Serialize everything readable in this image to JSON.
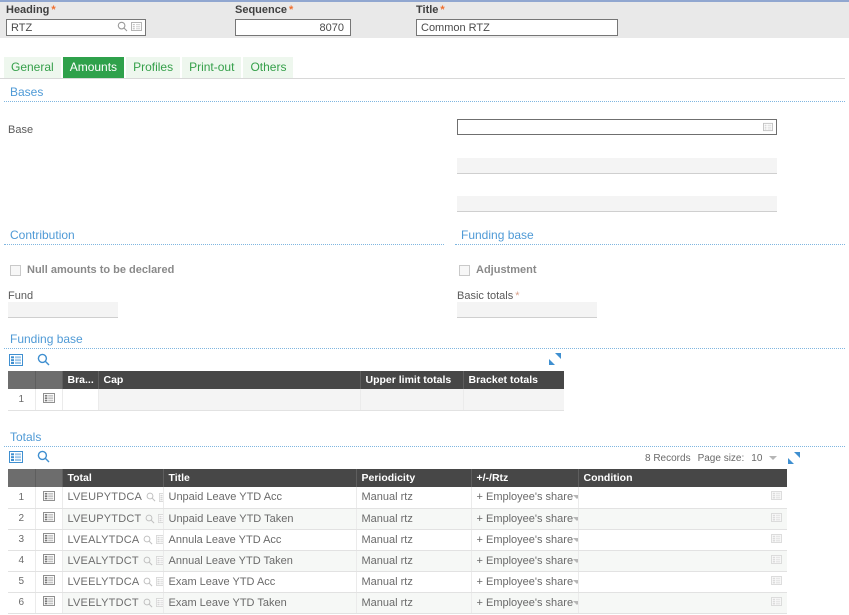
{
  "header": {
    "heading": {
      "label": "Heading",
      "value": "RTZ",
      "required": true
    },
    "sequence": {
      "label": "Sequence",
      "value": "8070",
      "required": true
    },
    "title": {
      "label": "Title",
      "value": "Common RTZ",
      "required": true
    },
    "required_marker": "*"
  },
  "tabs": [
    {
      "label": "General",
      "active": false
    },
    {
      "label": "Amounts",
      "active": true
    },
    {
      "label": "Profiles",
      "active": false
    },
    {
      "label": "Print-out",
      "active": false
    },
    {
      "label": "Others",
      "active": false
    }
  ],
  "bases": {
    "title": "Bases",
    "base_label": "Base",
    "base_value": "",
    "extra_rows": [
      "",
      ""
    ]
  },
  "contribution": {
    "title": "Contribution",
    "null_amounts_label": "Null amounts to be declared",
    "null_amounts_checked": false,
    "fund_label": "Fund",
    "fund_value": ""
  },
  "funding_base_panel": {
    "title": "Funding base",
    "adjustment_label": "Adjustment",
    "adjustment_checked": false,
    "basic_totals_label": "Basic totals",
    "basic_totals_required": "*",
    "basic_totals_value": ""
  },
  "funding_base_grid": {
    "title": "Funding base",
    "columns": [
      "",
      "",
      "Bra...",
      "Cap",
      "Upper limit totals",
      "Bracket totals"
    ],
    "rows": [
      {
        "num": "1",
        "bracket": "",
        "cap": "",
        "upper_limit": "",
        "bracket_totals": ""
      }
    ]
  },
  "totals_grid": {
    "title": "Totals",
    "records_text": "8 Records",
    "page_size_label": "Page size:",
    "page_size_value": "10",
    "columns": [
      "",
      "",
      "Total",
      "Title",
      "Periodicity",
      "+/-/Rtz",
      "Condition"
    ],
    "rows": [
      {
        "num": "1",
        "total": "LVEUPYTDCA",
        "title": "Unpaid Leave YTD Acc",
        "periodicity": "Manual rtz",
        "sign": "+ Employee's share",
        "condition": ""
      },
      {
        "num": "2",
        "total": "LVEUPYTDCT",
        "title": "Unpaid Leave YTD Taken",
        "periodicity": "Manual rtz",
        "sign": "+ Employee's share",
        "condition": ""
      },
      {
        "num": "3",
        "total": "LVEALYTDCA",
        "title": "Annula Leave YTD Acc",
        "periodicity": "Manual rtz",
        "sign": "+ Employee's share",
        "condition": ""
      },
      {
        "num": "4",
        "total": "LVEALYTDCT",
        "title": "Annual Leave YTD Taken",
        "periodicity": "Manual rtz",
        "sign": "+ Employee's share",
        "condition": ""
      },
      {
        "num": "5",
        "total": "LVEELYTDCA",
        "title": "Exam Leave YTD Acc",
        "periodicity": "Manual rtz",
        "sign": "+ Employee's share",
        "condition": ""
      },
      {
        "num": "6",
        "total": "LVEELYTDCT",
        "title": "Exam Leave YTD Taken",
        "periodicity": "Manual rtz",
        "sign": "+ Employee's share",
        "condition": ""
      }
    ]
  },
  "icons": {
    "search": "search-icon",
    "list": "list-icon",
    "expand": "expand-icon",
    "row_detail": "row-detail-icon",
    "dropdown": "chevron-down-icon"
  },
  "colors": {
    "accent_green": "#2fa14b",
    "section_blue": "#4f9ad6",
    "header_dark": "#474747",
    "required_orange": "#f07030"
  }
}
